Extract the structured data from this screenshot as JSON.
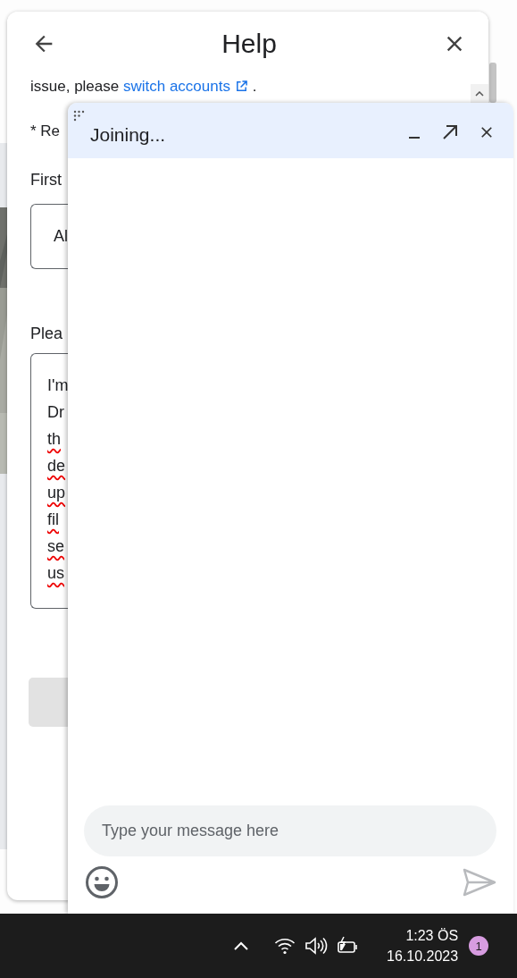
{
  "help_panel": {
    "title": "Help",
    "account_notice": {
      "before": "issue, please ",
      "link": "switch accounts",
      "after": " ."
    },
    "required_note": "* Re",
    "first_name": {
      "label": "First",
      "value": "Al"
    },
    "description": {
      "label": "Plea",
      "lines": [
        {
          "text": "I'm",
          "misspelled": false
        },
        {
          "text": "Dr",
          "misspelled": false
        },
        {
          "text": "th",
          "misspelled": true
        },
        {
          "text": "de",
          "misspelled": true
        },
        {
          "text": "up",
          "misspelled": true
        },
        {
          "text": "fil",
          "misspelled": true
        },
        {
          "text": "se",
          "misspelled": true
        },
        {
          "text": "us",
          "misspelled": true
        }
      ]
    },
    "submit_button": {
      "disabled": true
    }
  },
  "chat": {
    "title": "Joining...",
    "message_input": {
      "placeholder": "Type your message here"
    },
    "send_button": {
      "disabled": true
    }
  },
  "taskbar": {
    "time": "1:23 ÖS",
    "date": "16.10.2023",
    "notification_count": "1"
  }
}
